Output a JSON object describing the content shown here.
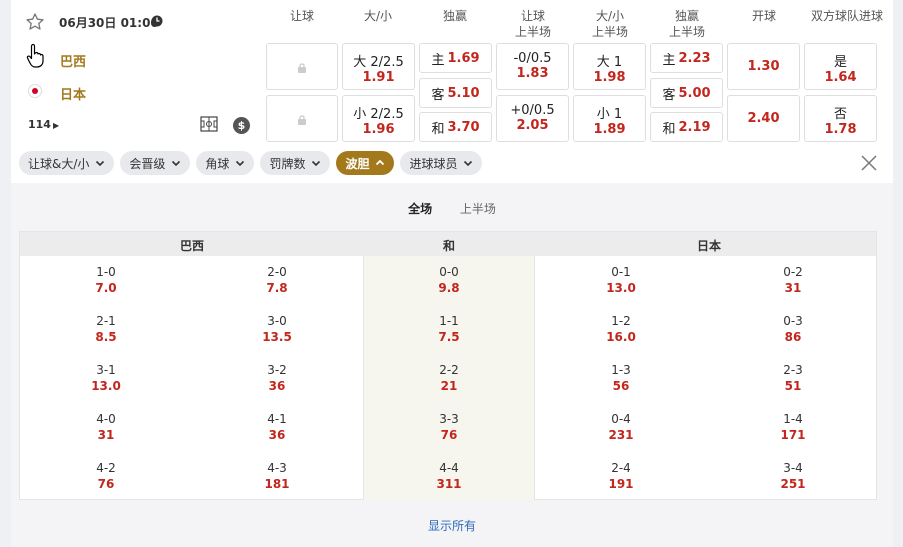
{
  "match": {
    "datetime": "06月30日 01:00",
    "home": "巴西",
    "away": "日本",
    "more_count": "114"
  },
  "columns": [
    "让球",
    "大/小",
    "独赢",
    "让球\n上半场",
    "大/小\n上半场",
    "独赢\n上半场",
    "开球",
    "双方球队进球"
  ],
  "odds": {
    "ou_1": {
      "label": "大 2/2.5",
      "value": "1.91"
    },
    "ou_2": {
      "label": "小 2/2.5",
      "value": "1.96"
    },
    "ml_home": {
      "label": "主",
      "value": "1.69"
    },
    "ml_away": {
      "label": "客",
      "value": "5.10"
    },
    "ml_draw": {
      "label": "和",
      "value": "3.70"
    },
    "h1hcp_1": {
      "label": "-0/0.5",
      "value": "1.83"
    },
    "h1hcp_2": {
      "label": "+0/0.5",
      "value": "2.05"
    },
    "h1ou_1": {
      "label": "大 1",
      "value": "1.98"
    },
    "h1ou_2": {
      "label": "小 1",
      "value": "1.89"
    },
    "h1ml_home": {
      "label": "主",
      "value": "2.23"
    },
    "h1ml_away": {
      "label": "客",
      "value": "5.00"
    },
    "h1ml_draw": {
      "label": "和",
      "value": "2.19"
    },
    "kickoff_1": {
      "value": "1.30"
    },
    "kickoff_2": {
      "value": "2.40"
    },
    "btts_yes": {
      "label": "是",
      "value": "1.64"
    },
    "btts_no": {
      "label": "否",
      "value": "1.78"
    }
  },
  "chips": [
    {
      "label": "让球&大/小",
      "active": false
    },
    {
      "label": "会晋级",
      "active": false
    },
    {
      "label": "角球",
      "active": false
    },
    {
      "label": "罚牌数",
      "active": false
    },
    {
      "label": "波胆",
      "active": true
    },
    {
      "label": "进球球员",
      "active": false
    }
  ],
  "correct_score": {
    "tabs": [
      {
        "label": "全场",
        "active": true
      },
      {
        "label": "上半场",
        "active": false
      }
    ],
    "headers": {
      "home": "巴西",
      "draw": "和",
      "away": "日本"
    },
    "rows": [
      [
        {
          "s": "1-0",
          "o": "7.0"
        },
        {
          "s": "2-0",
          "o": "7.8"
        },
        {
          "s": "0-0",
          "o": "9.8"
        },
        {
          "s": "0-1",
          "o": "13.0"
        },
        {
          "s": "0-2",
          "o": "31"
        }
      ],
      [
        {
          "s": "2-1",
          "o": "8.5"
        },
        {
          "s": "3-0",
          "o": "13.5"
        },
        {
          "s": "1-1",
          "o": "7.5"
        },
        {
          "s": "1-2",
          "o": "16.0"
        },
        {
          "s": "0-3",
          "o": "86"
        }
      ],
      [
        {
          "s": "3-1",
          "o": "13.0"
        },
        {
          "s": "3-2",
          "o": "36"
        },
        {
          "s": "2-2",
          "o": "21"
        },
        {
          "s": "1-3",
          "o": "56"
        },
        {
          "s": "2-3",
          "o": "51"
        }
      ],
      [
        {
          "s": "4-0",
          "o": "31"
        },
        {
          "s": "4-1",
          "o": "36"
        },
        {
          "s": "3-3",
          "o": "76"
        },
        {
          "s": "0-4",
          "o": "231"
        },
        {
          "s": "1-4",
          "o": "171"
        }
      ],
      [
        {
          "s": "4-2",
          "o": "76"
        },
        {
          "s": "4-3",
          "o": "181"
        },
        {
          "s": "4-4",
          "o": "311"
        },
        {
          "s": "2-4",
          "o": "191"
        },
        {
          "s": "3-4",
          "o": "251"
        }
      ]
    ],
    "show_all": "显示所有"
  },
  "colors": {
    "accent": "#a3791c",
    "odds": "#c2261d",
    "link": "#2b6cb8"
  }
}
